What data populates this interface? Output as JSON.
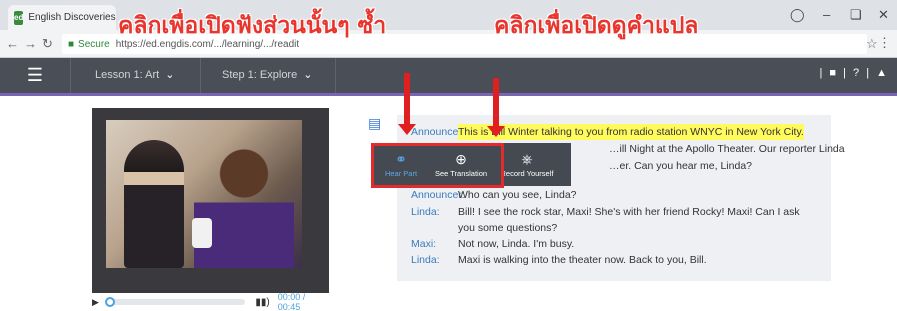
{
  "browser": {
    "tab_title": "English Discoveries",
    "favicon_text": "ed",
    "secure_label": "Secure",
    "url": "https://ed.engdis.com/.../learning/.../readit"
  },
  "appnav": {
    "lesson": "Lesson 1: Art",
    "step": "Step 1: Explore",
    "help": "?"
  },
  "annotations": {
    "hear_part_note": "คลิกเพื่อเปิดฟังส่วนนั้นๆ ซ้ำ",
    "translation_note": "คลิกเพื่อเปิดดูคำแปล"
  },
  "popup": {
    "hear_part": "Hear Part",
    "see_translation": "See Translation",
    "record_yourself": "Record Yourself"
  },
  "player": {
    "time": "00:00 / 00:45"
  },
  "transcript": [
    {
      "speaker": "Announcer:",
      "text": "This is Bill Winter talking to you from radio station WNYC in New York City.",
      "highlight": true
    },
    {
      "speaker": "",
      "text": "…ill Night at the Apollo Theater. Our reporter Linda",
      "highlight": false
    },
    {
      "speaker": "",
      "text": "…er. Can you hear me, Linda?",
      "highlight": false
    },
    {
      "speaker": "Announcer:",
      "text": "Who can you see, Linda?",
      "highlight": false
    },
    {
      "speaker": "Linda:",
      "text": "Bill! I see the rock star, Maxi! She's with her friend Rocky! Maxi! Can I ask",
      "highlight": false
    },
    {
      "speaker": "",
      "text": "you some questions?",
      "highlight": false
    },
    {
      "speaker": "Maxi:",
      "text": "Not now, Linda. I'm busy.",
      "highlight": false
    },
    {
      "speaker": "Linda:",
      "text": "Maxi is walking into the theater now. Back to you, Bill.",
      "highlight": false
    }
  ],
  "colors": {
    "nav_bg": "#4a4f57",
    "accent_purple": "#7b63b5",
    "speaker_blue": "#3b7bbf",
    "highlight_yellow": "#fffb5c",
    "annotation_red": "#e8352d"
  }
}
